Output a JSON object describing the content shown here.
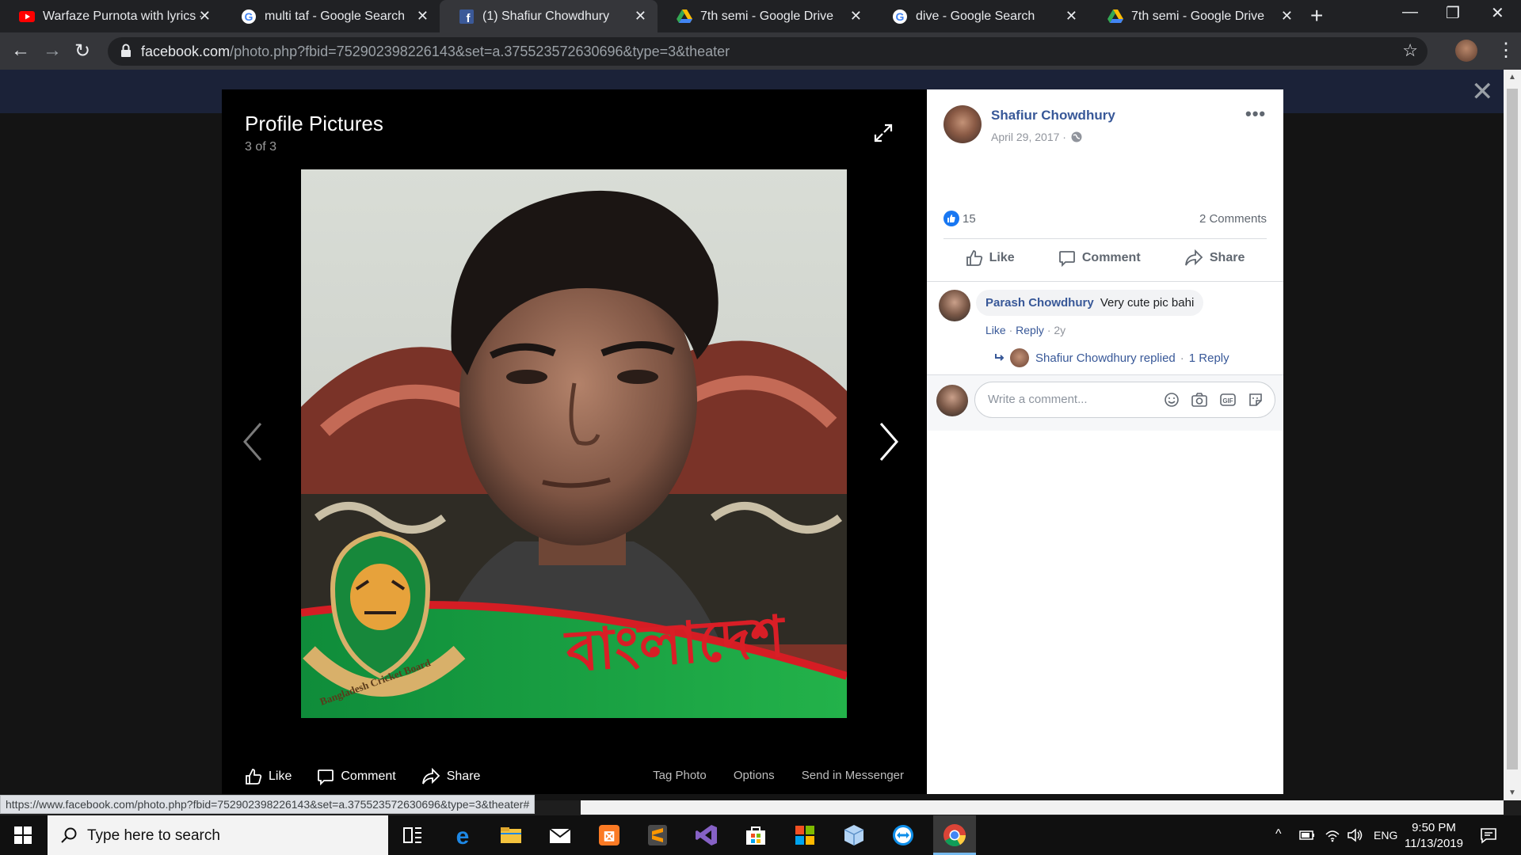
{
  "browser": {
    "tabs": [
      {
        "title": "Warfaze Purnota with lyrics -",
        "icon": "youtube-icon",
        "active": false
      },
      {
        "title": "multi taf - Google Search",
        "icon": "google-icon",
        "active": false
      },
      {
        "title": "(1) Shafiur Chowdhury",
        "icon": "facebook-icon",
        "active": true
      },
      {
        "title": "7th semi - Google Drive",
        "icon": "drive-icon",
        "active": false
      },
      {
        "title": "dive - Google Search",
        "icon": "google-icon",
        "active": false
      },
      {
        "title": "7th semi - Google Drive",
        "icon": "drive-icon",
        "active": false
      }
    ],
    "url_host": "facebook.com",
    "url_rest": "/photo.php?fbid=752902398226143&set=a.375523572630696&type=3&theater",
    "status_url": "https://www.facebook.com/photo.php?fbid=752902398226143&set=a.375523572630696&type=3&theater#"
  },
  "viewer": {
    "album_title": "Profile Pictures",
    "counter": "3 of 3",
    "actions": {
      "like": "Like",
      "comment": "Comment",
      "share": "Share"
    },
    "options": {
      "tag": "Tag Photo",
      "options": "Options",
      "messenger": "Send in Messenger"
    },
    "photo_overlay_text": "বাংলাদেশ",
    "badge_text": "Bangladesh Cricket Board"
  },
  "post": {
    "author": "Shafiur Chowdhury",
    "date": "April 29, 2017 ·",
    "like_count": "15",
    "comment_count": "2 Comments",
    "actions": {
      "like": "Like",
      "comment": "Comment",
      "share": "Share"
    },
    "comment": {
      "author": "Parash Chowdhury",
      "text": "Very cute pic bahi",
      "like": "Like",
      "reply": "Reply",
      "age": "2y",
      "replied_by": "Shafiur Chowdhury replied",
      "reply_count": "1 Reply"
    },
    "composer_placeholder": "Write a comment..."
  },
  "taskbar": {
    "search_placeholder": "Type here to search",
    "language": "ENG",
    "time": "9:50 PM",
    "date": "11/13/2019"
  },
  "colors": {
    "facebook_blue": "#385898",
    "like_blue": "#1877f2",
    "chrome_dark": "#202124",
    "chrome_toolbar": "#35363a"
  }
}
